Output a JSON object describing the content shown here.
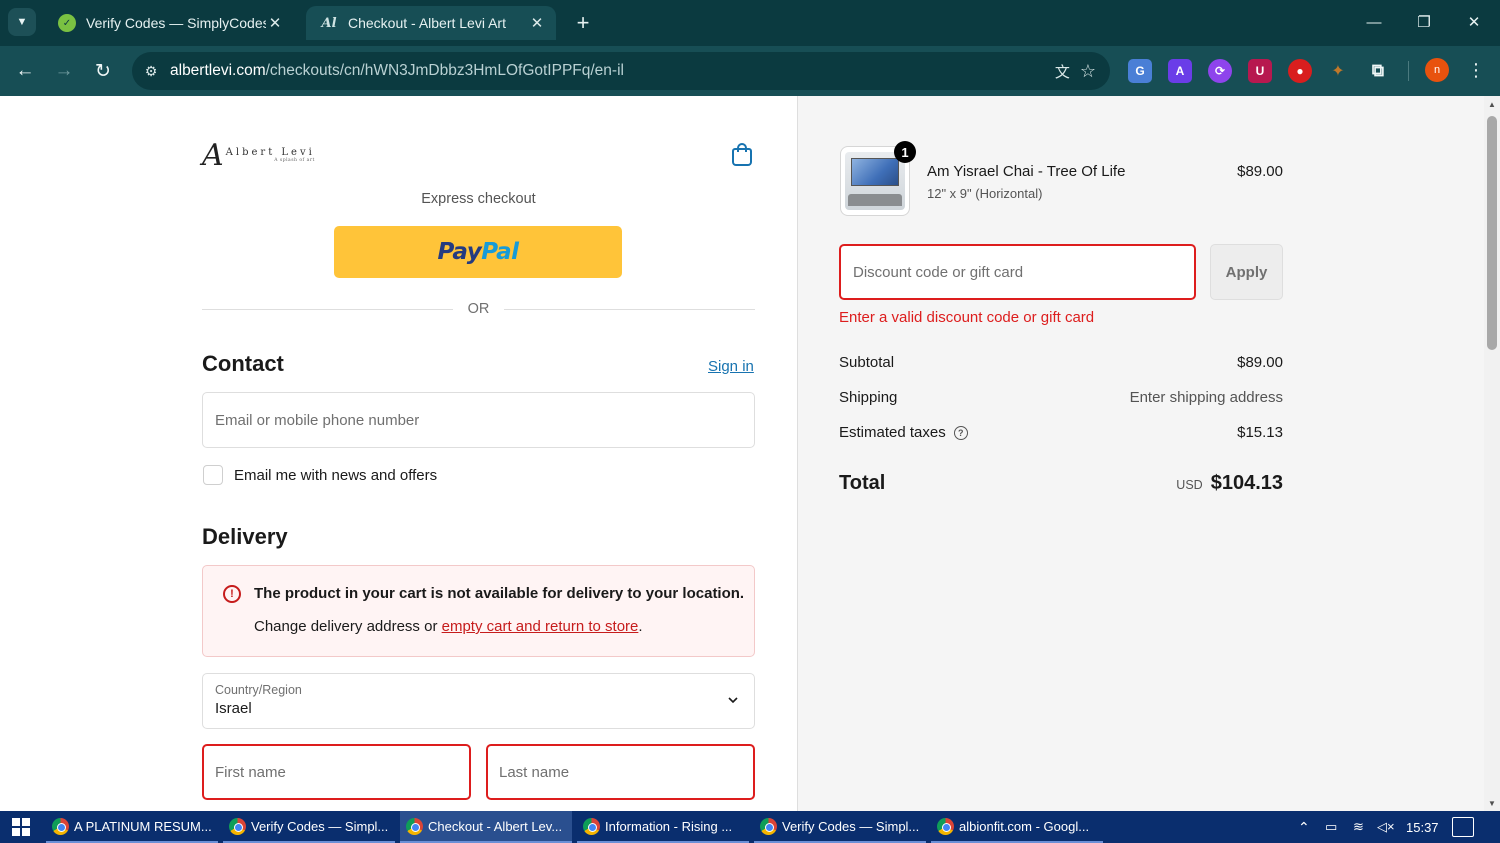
{
  "browser": {
    "tabs": [
      {
        "title": "Verify Codes — SimplyCodes",
        "active": false
      },
      {
        "title": "Checkout - Albert Levi Art",
        "active": true
      }
    ],
    "address_host": "albertlevi.com",
    "address_path": "/checkouts/cn/hWN3JmDbbz3HmLOfGotIPPFq/en-il",
    "profile_initial": "n"
  },
  "header": {
    "logo_mark": "A",
    "logo_name": "Albert Levi",
    "logo_tagline": "A splash of art"
  },
  "express": {
    "label": "Express checkout",
    "paypal_part1": "Pay",
    "paypal_part2": "Pal",
    "divider": "OR"
  },
  "contact": {
    "title": "Contact",
    "signin": "Sign in",
    "email_placeholder": "Email or mobile phone number",
    "newsletter_label": "Email me with news and offers"
  },
  "delivery": {
    "title": "Delivery",
    "alert_title": "The product in your cart is not available for delivery to your location.",
    "alert_text_before": "Change delivery address or ",
    "alert_link": "empty cart and return to store",
    "alert_text_after": ".",
    "country_label": "Country/Region",
    "country_value": "Israel",
    "first_name_placeholder": "First name",
    "last_name_placeholder": "Last name"
  },
  "summary": {
    "product": {
      "name": "Am Yisrael Chai - Tree Of Life",
      "variant": "12\" x 9\" (Horizontal)",
      "price": "$89.00",
      "quantity": "1"
    },
    "discount_placeholder": "Discount code or gift card",
    "apply_label": "Apply",
    "discount_error": "Enter a valid discount code or gift card",
    "subtotal_label": "Subtotal",
    "subtotal_value": "$89.00",
    "shipping_label": "Shipping",
    "shipping_value": "Enter shipping address",
    "taxes_label": "Estimated taxes",
    "taxes_value": "$15.13",
    "total_label": "Total",
    "currency": "USD",
    "total_value": "$104.13"
  },
  "taskbar": {
    "items": [
      "A PLATINUM RESUM...",
      "Verify Codes — Simpl...",
      "Checkout - Albert Lev...",
      "Information - Rising ...",
      "Verify Codes — Simpl...",
      "albionfit.com - Googl..."
    ],
    "time": "15:37"
  },
  "colors": {
    "chrome_dark": "#0b3a40",
    "chrome_toolbar": "#174e55",
    "error": "#dd1d1d",
    "link": "#1773b0",
    "paypal_yellow": "#ffc439",
    "taskbar": "#0a2e6e"
  }
}
